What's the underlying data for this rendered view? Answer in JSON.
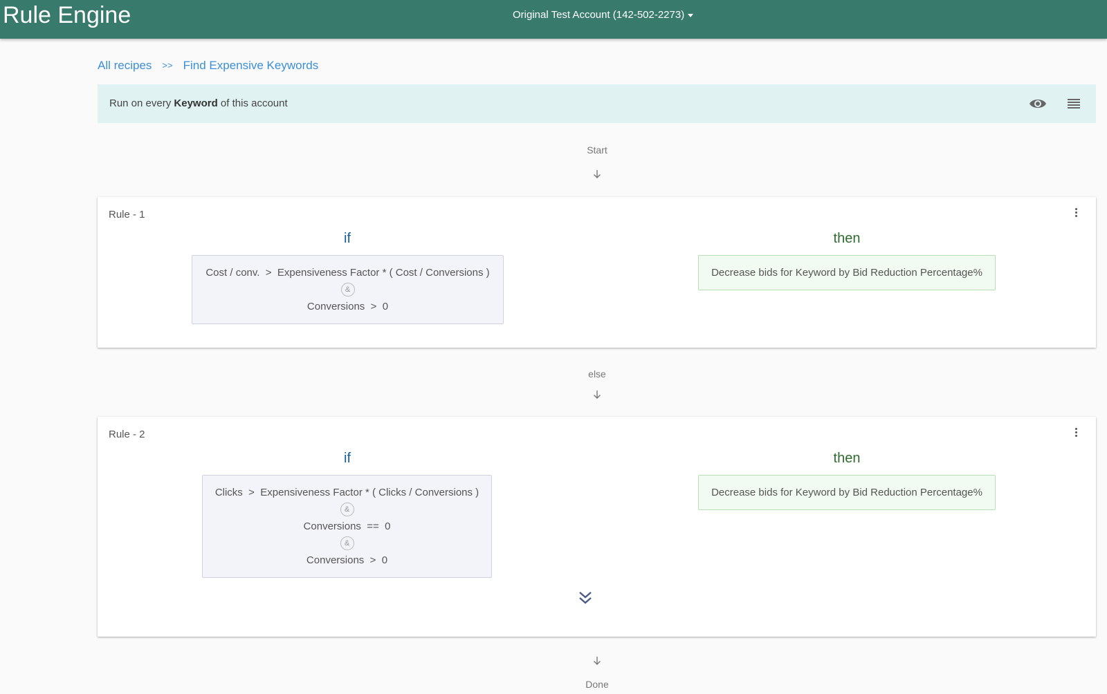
{
  "header": {
    "app_title": "Rule Engine",
    "account_label": "Original Test Account (142-502-2273)"
  },
  "breadcrumb": {
    "root": "All recipes",
    "separator": ">>",
    "current": "Find Expensive Keywords"
  },
  "run_bar": {
    "prefix": "Run on every",
    "entity": "Keyword",
    "suffix": "of this account",
    "icons": [
      "eye-icon",
      "list-icon"
    ]
  },
  "flow": {
    "start_label": "Start",
    "else_label": "else",
    "done_label": "Done"
  },
  "rules": [
    {
      "title": "Rule - 1",
      "if_label": "if",
      "then_label": "then",
      "conditions": [
        "Cost / conv.  >  Expensiveness Factor * ( Cost / Conversions )",
        "Conversions  >  0"
      ],
      "conjunction": "&",
      "action": "Decrease bids for Keyword by Bid Reduction Percentage%"
    },
    {
      "title": "Rule - 2",
      "if_label": "if",
      "then_label": "then",
      "conditions": [
        "Clicks  >  Expensiveness Factor * ( Clicks / Conversions )",
        "Conversions  ==  0",
        "Conversions  >  0"
      ],
      "conjunction": "&",
      "action": "Decrease bids for Keyword by Bid Reduction Percentage%"
    }
  ],
  "colors": {
    "header_bg": "#387a6c",
    "run_bar_bg": "#e0f2f1",
    "link": "#3b8ed8",
    "if_label": "#1a5e9a",
    "then_label": "#2e6b2e",
    "condition_bg": "#f3f4f9",
    "action_bg": "#f2fbf1"
  }
}
